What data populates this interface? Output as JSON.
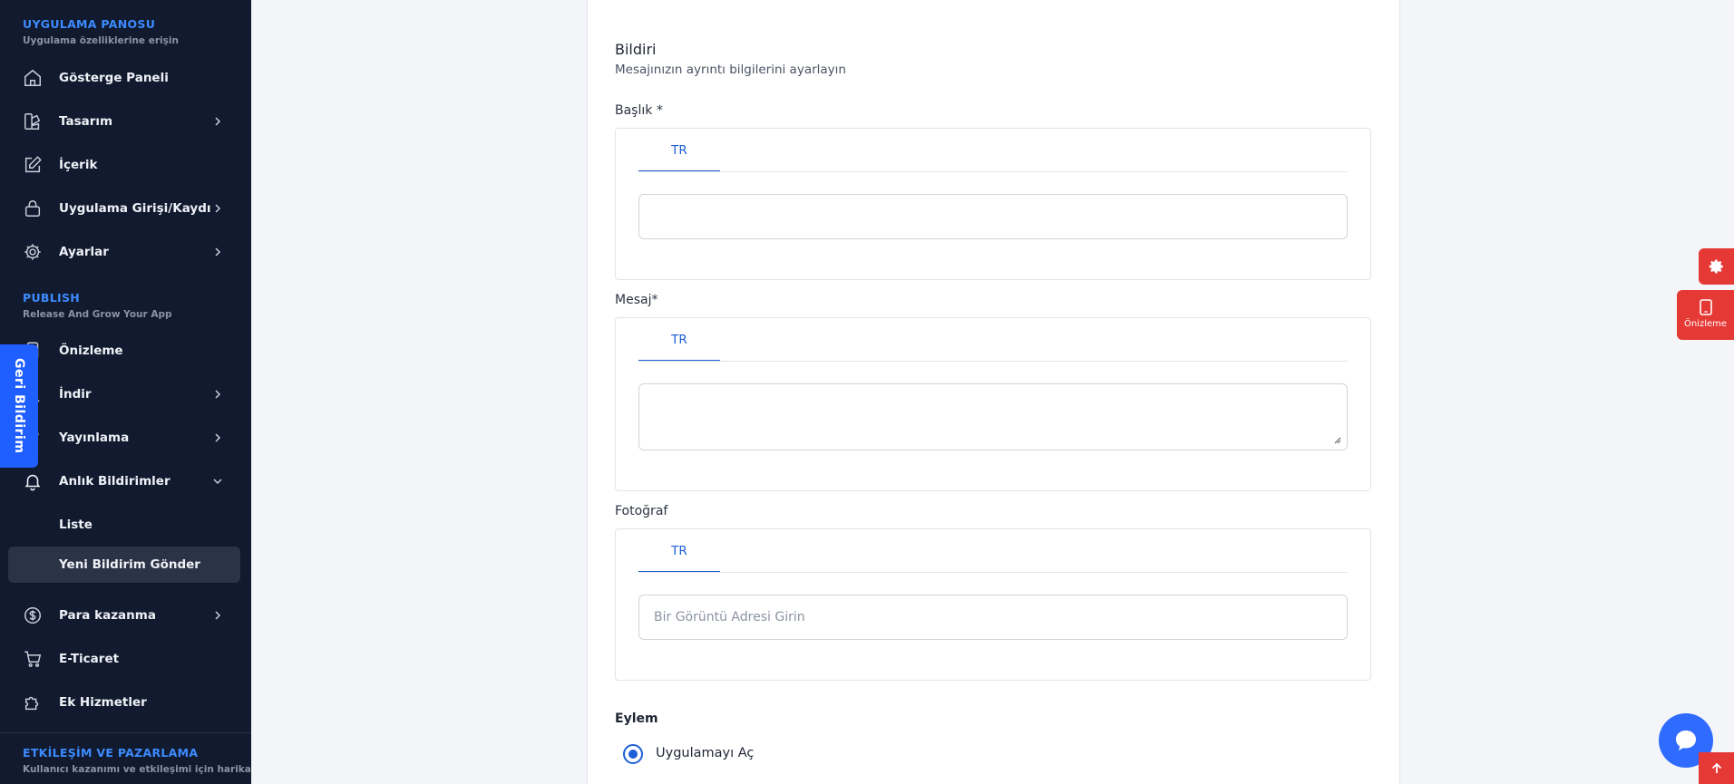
{
  "sidebar": {
    "section1": {
      "title": "UYGULAMA PANOSU",
      "subtitle": "Uygulama özelliklerine erişin"
    },
    "section2": {
      "title": "PUBLISH",
      "subtitle": "Release And Grow Your App"
    },
    "section3": {
      "title": "ETKİLEŞİM VE PAZARLAMA",
      "subtitle": "Kullanıcı kazanımı ve etkileşimi için harika"
    },
    "items": {
      "dashboard": "Gösterge Paneli",
      "design": "Tasarım",
      "content": "İçerik",
      "login": "Uygulama Girişi/Kaydı",
      "settings": "Ayarlar",
      "preview": "Önizleme",
      "download": "İndir",
      "publishing": "Yayınlama",
      "push": "Anlık Bildirimler",
      "push_list": "Liste",
      "push_new": "Yeni Bildirim Gönder",
      "monetize": "Para kazanma",
      "ecommerce": "E-Ticaret",
      "addons": "Ek Hizmetler"
    },
    "feedback": "Geri Bildirim"
  },
  "form": {
    "title": "Bildiri",
    "subtitle": "Mesajınızın ayrıntı bilgilerini ayarlayın",
    "title_label": "Başlık *",
    "message_label": "Mesaj*",
    "photo_label": "Fotoğraf",
    "tab_lang": "TR",
    "title_value": "",
    "message_value": "",
    "photo_placeholder": "Bir Görüntü Adresi Girin",
    "action_label": "Eylem",
    "action_option": "Uygulamayı Aç"
  },
  "floating": {
    "preview": "Önizleme"
  },
  "colors": {
    "sidebar_bg": "#111a2e",
    "accent_blue": "#1f5fd6",
    "danger_red": "#e53935"
  }
}
